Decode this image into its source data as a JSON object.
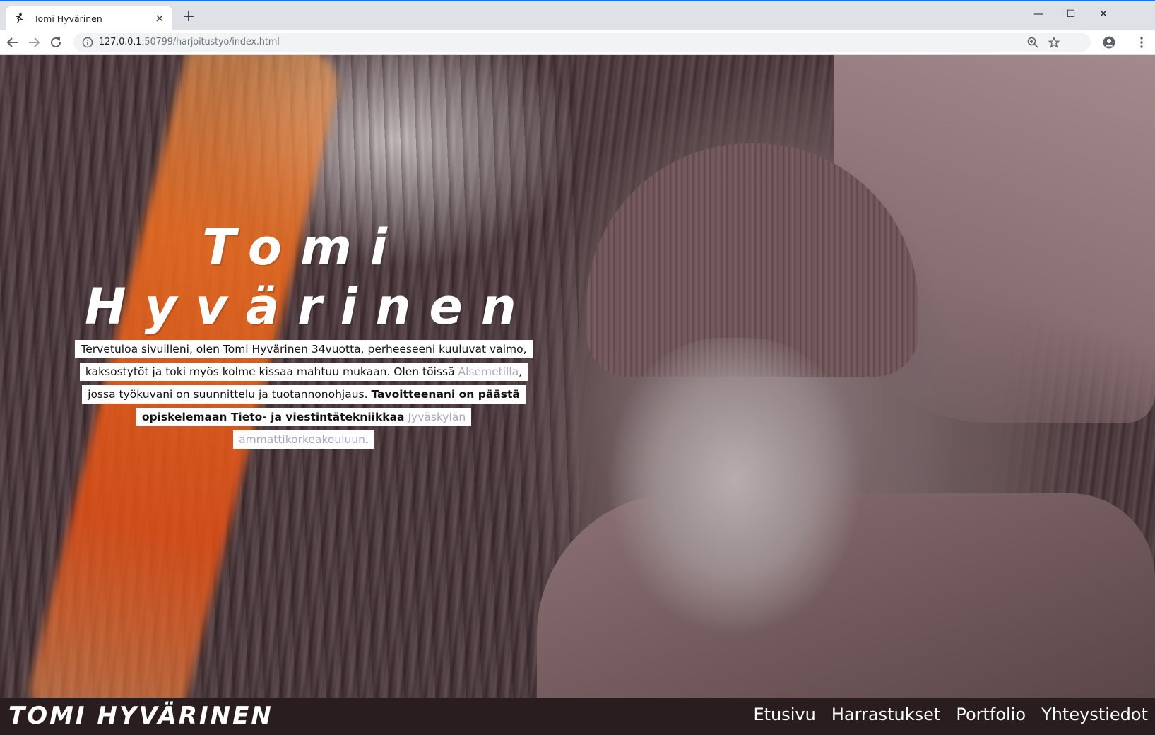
{
  "browser": {
    "tab": {
      "title": "Tomi Hyvärinen",
      "close": "×",
      "favicon": "runner-icon"
    },
    "new_tab": "+",
    "window_controls": {
      "minimize": "—",
      "maximize": "☐",
      "close": "✕"
    },
    "url": {
      "host": "127.0.0.1",
      "rest": ":50799/harjoitustyo/index.html"
    },
    "icons": [
      "back-icon",
      "forward-icon",
      "reload-icon",
      "info-icon",
      "zoom-icon",
      "star-icon",
      "account-icon",
      "menu-icon"
    ]
  },
  "hero": {
    "title_line1": "Tomi",
    "title_line2": "Hyvärinen",
    "intro": {
      "part1": "Tervetuloa sivuilleni, olen Tomi Hyvärinen 34vuotta, perheeseeni kuuluvat vaimo, kaksostytöt ja toki myös kolme kissaa mahtuu mukaan. Olen töissä ",
      "link1": "Alsemetilla",
      "part2": ", jossa työkuvani on suunnittelu ja tuotannonohjaus. ",
      "bold": "Tavoitteenani on päästä opiskelemaan Tieto- ja viestintätekniikkaa",
      "part3": " ",
      "link2": "Jyväskylän ammattikorkeakouluun",
      "part4": "."
    }
  },
  "footer": {
    "brand": "Tomi Hyvärinen",
    "nav": [
      "Etusivu",
      "Harrastukset",
      "Portfolio",
      "Yhteystiedot"
    ]
  },
  "colors": {
    "chrome_bg": "#dee1e6",
    "footer_bg": "#2a1d1f",
    "link": "#a9a6c4",
    "flare": "#f36e1e"
  }
}
